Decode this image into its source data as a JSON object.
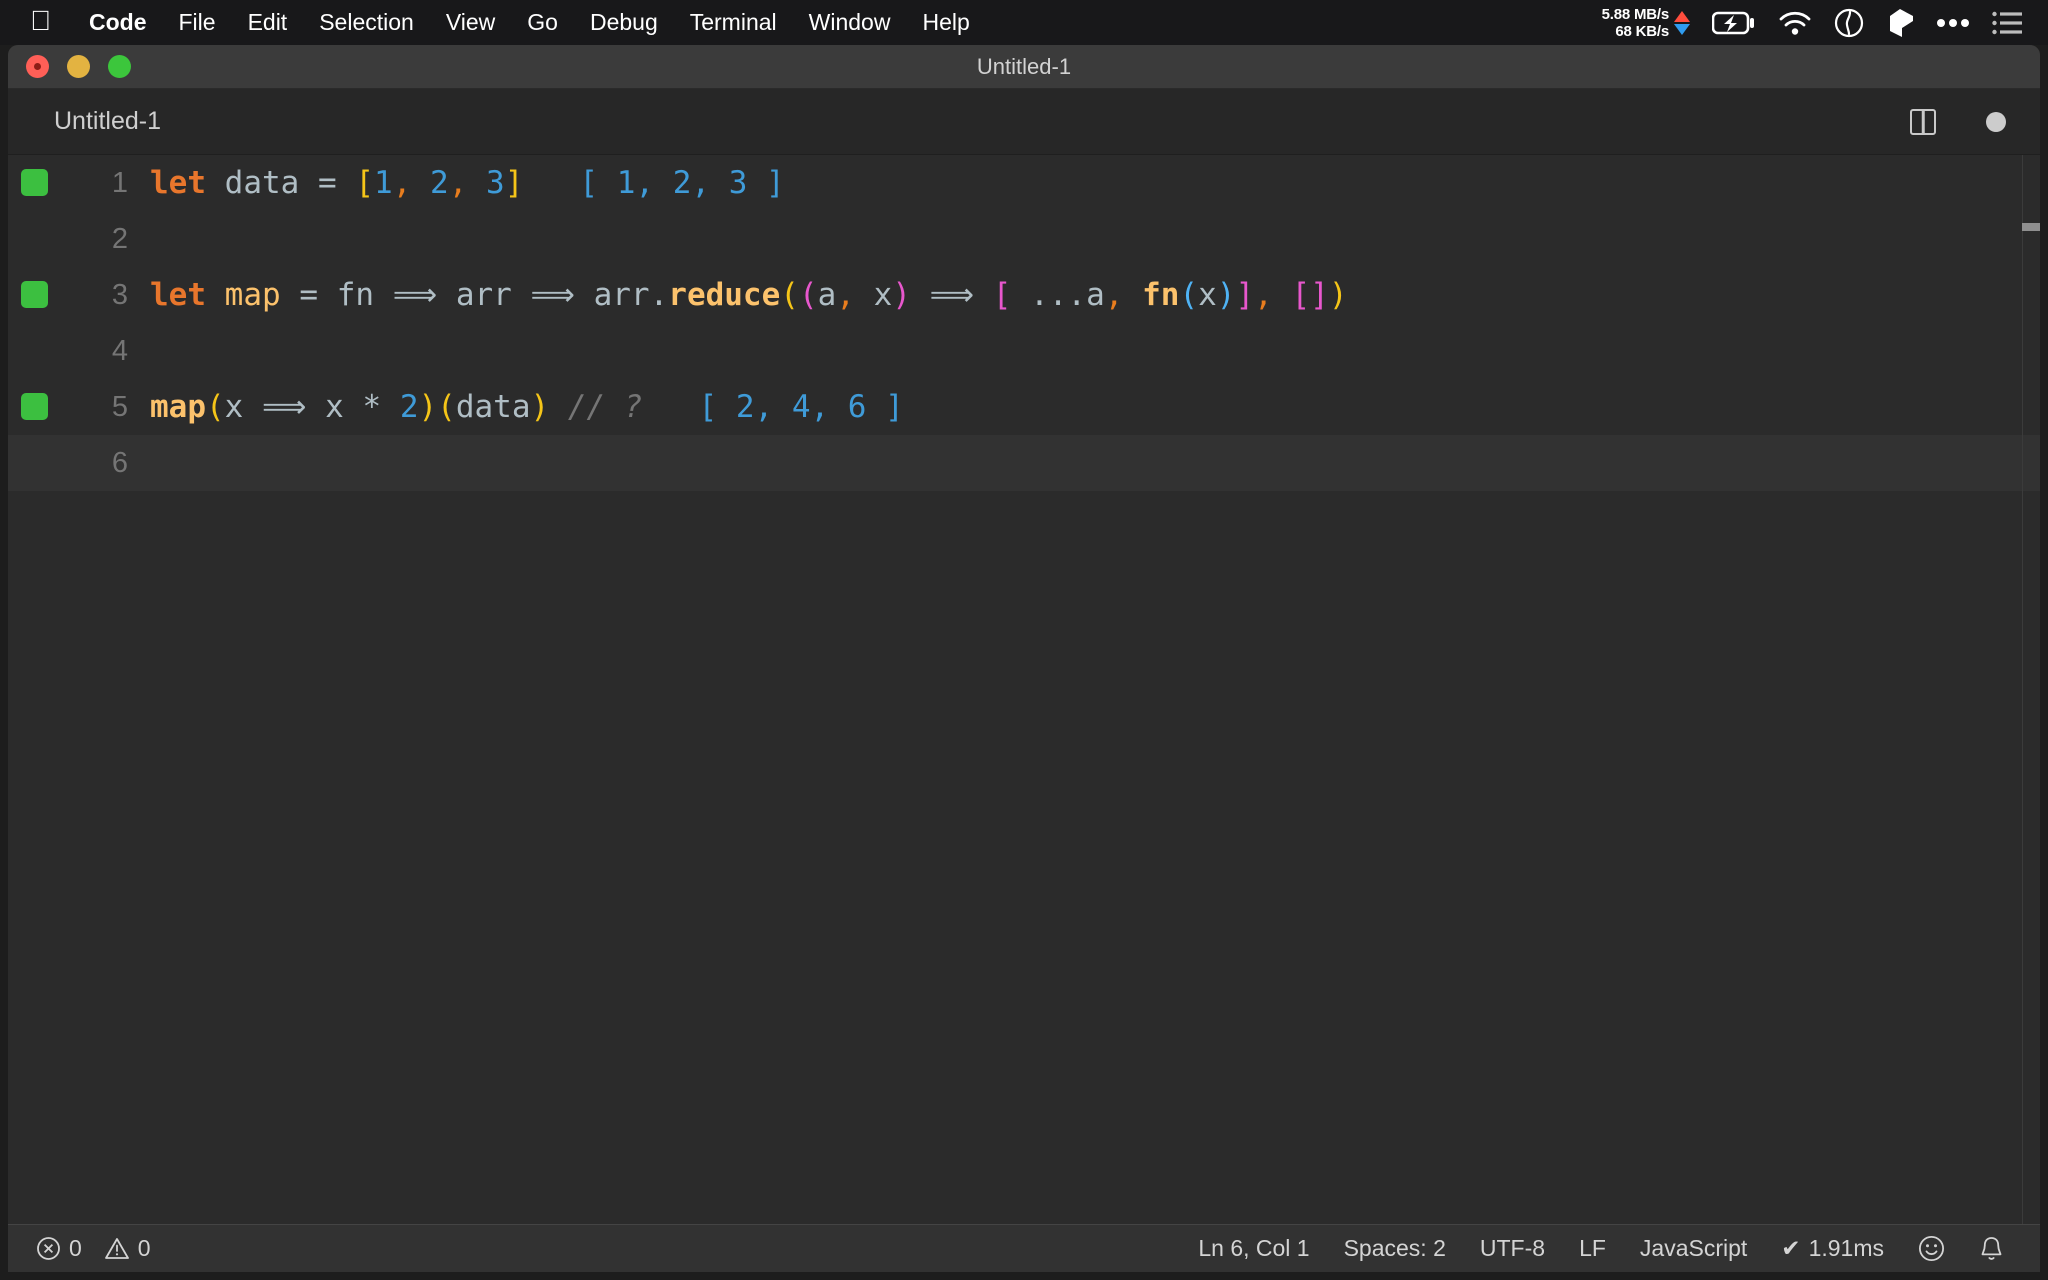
{
  "menubar": {
    "apple_icon": "apple-logo-icon",
    "items": [
      {
        "label": "Code",
        "bold": true
      },
      {
        "label": "File",
        "bold": false
      },
      {
        "label": "Edit",
        "bold": false
      },
      {
        "label": "Selection",
        "bold": false
      },
      {
        "label": "View",
        "bold": false
      },
      {
        "label": "Go",
        "bold": false
      },
      {
        "label": "Debug",
        "bold": false
      },
      {
        "label": "Terminal",
        "bold": false
      },
      {
        "label": "Window",
        "bold": false
      },
      {
        "label": "Help",
        "bold": false
      }
    ],
    "status": {
      "upload_speed": "5.88 MB/s",
      "download_speed": "68 KB/s",
      "icons": [
        "battery-charging-icon",
        "wifi-icon",
        "clock-icon",
        "cube-icon",
        "ellipsis-icon",
        "list-icon"
      ]
    }
  },
  "window": {
    "title": "Untitled-1",
    "traffic_lights": [
      "close-button",
      "minimize-button",
      "maximize-button"
    ]
  },
  "tabbar": {
    "active_tab": "Untitled-1",
    "split_editor_icon": "split-editor-icon",
    "dirty_indicator": "unsaved-changes-dot"
  },
  "editor": {
    "language": "JavaScript",
    "lines": [
      {
        "number": "1",
        "has_run_marker": true,
        "current": false,
        "tokens": [
          {
            "text": "let",
            "cls": "t-kw"
          },
          {
            "text": " ",
            "cls": "t-plain"
          },
          {
            "text": "data",
            "cls": "t-var"
          },
          {
            "text": " ",
            "cls": "t-plain"
          },
          {
            "text": "=",
            "cls": "t-plain"
          },
          {
            "text": " ",
            "cls": "t-plain"
          },
          {
            "text": "[",
            "cls": "t-b1"
          },
          {
            "text": "1",
            "cls": "t-num"
          },
          {
            "text": ",",
            "cls": "t-punc-o"
          },
          {
            "text": " ",
            "cls": "t-plain"
          },
          {
            "text": "2",
            "cls": "t-num"
          },
          {
            "text": ",",
            "cls": "t-punc-o"
          },
          {
            "text": " ",
            "cls": "t-plain"
          },
          {
            "text": "3",
            "cls": "t-num"
          },
          {
            "text": "]",
            "cls": "t-b1"
          },
          {
            "text": "   ",
            "cls": "t-plain"
          },
          {
            "text": "[ 1, 2, 3 ]",
            "cls": "t-result"
          }
        ],
        "source": "let data = [1, 2, 3]",
        "inline_result": "[ 1, 2, 3 ]"
      },
      {
        "number": "2",
        "has_run_marker": false,
        "current": false,
        "tokens": [],
        "source": "",
        "inline_result": ""
      },
      {
        "number": "3",
        "has_run_marker": true,
        "current": false,
        "tokens": [
          {
            "text": "let",
            "cls": "t-kw"
          },
          {
            "text": " ",
            "cls": "t-plain"
          },
          {
            "text": "map",
            "cls": "t-fn2"
          },
          {
            "text": " ",
            "cls": "t-plain"
          },
          {
            "text": "=",
            "cls": "t-plain"
          },
          {
            "text": " ",
            "cls": "t-plain"
          },
          {
            "text": "fn",
            "cls": "t-var"
          },
          {
            "text": " ",
            "cls": "t-plain"
          },
          {
            "text": "⟹",
            "cls": "t-arrow"
          },
          {
            "text": " ",
            "cls": "t-plain"
          },
          {
            "text": "arr",
            "cls": "t-var"
          },
          {
            "text": " ",
            "cls": "t-plain"
          },
          {
            "text": "⟹",
            "cls": "t-arrow"
          },
          {
            "text": " ",
            "cls": "t-plain"
          },
          {
            "text": "arr",
            "cls": "t-var"
          },
          {
            "text": ".",
            "cls": "t-var"
          },
          {
            "text": "reduce",
            "cls": "t-fn"
          },
          {
            "text": "(",
            "cls": "t-b1"
          },
          {
            "text": "(",
            "cls": "t-b2"
          },
          {
            "text": "a",
            "cls": "t-var"
          },
          {
            "text": ",",
            "cls": "t-punc-o"
          },
          {
            "text": " ",
            "cls": "t-plain"
          },
          {
            "text": "x",
            "cls": "t-var"
          },
          {
            "text": ")",
            "cls": "t-b2"
          },
          {
            "text": " ",
            "cls": "t-plain"
          },
          {
            "text": "⟹",
            "cls": "t-arrow"
          },
          {
            "text": " ",
            "cls": "t-plain"
          },
          {
            "text": "[",
            "cls": "t-b2"
          },
          {
            "text": " ",
            "cls": "t-plain"
          },
          {
            "text": "...",
            "cls": "t-var"
          },
          {
            "text": "a",
            "cls": "t-var"
          },
          {
            "text": ",",
            "cls": "t-punc-o"
          },
          {
            "text": " ",
            "cls": "t-plain"
          },
          {
            "text": "fn",
            "cls": "t-fn"
          },
          {
            "text": "(",
            "cls": "t-b3"
          },
          {
            "text": "x",
            "cls": "t-var"
          },
          {
            "text": ")",
            "cls": "t-b3"
          },
          {
            "text": "]",
            "cls": "t-b2"
          },
          {
            "text": ",",
            "cls": "t-punc-o"
          },
          {
            "text": " ",
            "cls": "t-plain"
          },
          {
            "text": "[",
            "cls": "t-b2"
          },
          {
            "text": "]",
            "cls": "t-b2"
          },
          {
            "text": ")",
            "cls": "t-b1"
          }
        ],
        "source": "let map = fn ⟹ arr ⟹ arr.reduce((a, x) ⟹ [ ...a, fn(x)], [])",
        "inline_result": ""
      },
      {
        "number": "4",
        "has_run_marker": false,
        "current": false,
        "tokens": [],
        "source": "",
        "inline_result": ""
      },
      {
        "number": "5",
        "has_run_marker": true,
        "current": false,
        "tokens": [
          {
            "text": "map",
            "cls": "t-fn"
          },
          {
            "text": "(",
            "cls": "t-b1"
          },
          {
            "text": "x",
            "cls": "t-var"
          },
          {
            "text": " ",
            "cls": "t-plain"
          },
          {
            "text": "⟹",
            "cls": "t-arrow"
          },
          {
            "text": " ",
            "cls": "t-plain"
          },
          {
            "text": "x",
            "cls": "t-var"
          },
          {
            "text": " ",
            "cls": "t-plain"
          },
          {
            "text": "*",
            "cls": "t-var"
          },
          {
            "text": " ",
            "cls": "t-plain"
          },
          {
            "text": "2",
            "cls": "t-num"
          },
          {
            "text": ")",
            "cls": "t-b1"
          },
          {
            "text": "(",
            "cls": "t-b1"
          },
          {
            "text": "data",
            "cls": "t-var"
          },
          {
            "text": ")",
            "cls": "t-b1"
          },
          {
            "text": " ",
            "cls": "t-plain"
          },
          {
            "text": "// ?",
            "cls": "t-comment"
          },
          {
            "text": "   ",
            "cls": "t-plain"
          },
          {
            "text": "[ 2, 4, 6 ]",
            "cls": "t-result"
          }
        ],
        "source": "map(x ⟹ x * 2)(data) // ?",
        "inline_result": "[ 2, 4, 6 ]"
      },
      {
        "number": "6",
        "has_run_marker": false,
        "current": true,
        "tokens": [],
        "source": "",
        "inline_result": ""
      }
    ]
  },
  "statusbar": {
    "errors": "0",
    "warnings": "0",
    "cursor_position": "Ln 6, Col 1",
    "indentation": "Spaces: 2",
    "encoding": "UTF-8",
    "line_ending": "LF",
    "language": "JavaScript",
    "run_time": "1.91ms",
    "feedback_icon": "smiley-icon",
    "notifications_icon": "bell-icon"
  },
  "colors": {
    "accent_green": "#3cbf40",
    "result_blue": "#3f9bd8",
    "keyword_orange": "#e8762c",
    "function_amber": "#fcc26c",
    "bracket_yellow": "#f5c518",
    "bracket_magenta": "#e857cd",
    "bracket_blue": "#4fb3f5",
    "editor_bg": "#2b2b2b",
    "statusbar_bg": "#323232"
  }
}
